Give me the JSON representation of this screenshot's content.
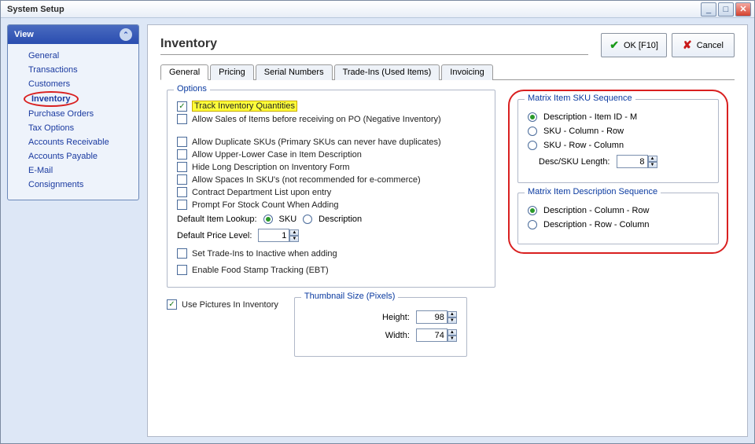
{
  "window_title": "System Setup",
  "buttons": {
    "ok": "OK [F10]",
    "cancel": "Cancel"
  },
  "sidebar": {
    "header": "View",
    "items": [
      {
        "label": "General"
      },
      {
        "label": "Transactions"
      },
      {
        "label": "Customers"
      },
      {
        "label": "Inventory",
        "active": true
      },
      {
        "label": "Purchase Orders"
      },
      {
        "label": "Tax Options"
      },
      {
        "label": "Accounts Receivable"
      },
      {
        "label": "Accounts Payable"
      },
      {
        "label": "E-Mail"
      },
      {
        "label": "Consignments"
      }
    ]
  },
  "page_title": "Inventory",
  "tabs": [
    {
      "label": "General",
      "active": true
    },
    {
      "label": "Pricing"
    },
    {
      "label": "Serial Numbers"
    },
    {
      "label": "Trade-Ins (Used Items)"
    },
    {
      "label": "Invoicing"
    }
  ],
  "options": {
    "legend": "Options",
    "track": "Track Inventory Quantities",
    "allow_neg": "Allow Sales of Items before receiving on PO (Negative Inventory)",
    "dup_sku": "Allow Duplicate SKUs (Primary SKUs can never have duplicates)",
    "upper_lower": "Allow Upper-Lower Case in Item Description",
    "hide_long": "Hide Long Description on Inventory Form",
    "spaces_sku": "Allow Spaces In SKU's (not recommended for e-commerce)",
    "contract_dept": "Contract Department List upon entry",
    "prompt_stock": "Prompt For Stock Count When Adding",
    "default_lookup_label": "Default Item Lookup:",
    "lookup_sku": "SKU",
    "lookup_desc": "Description",
    "default_price_label": "Default Price Level:",
    "default_price_value": "1",
    "tradeins": "Set Trade-Ins to Inactive when adding",
    "ebt": "Enable Food Stamp Tracking (EBT)"
  },
  "pictures": {
    "use_pics": "Use Pictures In Inventory",
    "thumb_legend": "Thumbnail Size (Pixels)",
    "height_label": "Height:",
    "height_value": "98",
    "width_label": "Width:",
    "width_value": "74"
  },
  "sku_seq": {
    "legend": "Matrix Item SKU Sequence",
    "opt1": "Description - Item ID - M",
    "opt2": "SKU - Column - Row",
    "opt3": "SKU - Row - Column",
    "len_label": "Desc/SKU Length:",
    "len_value": "8"
  },
  "desc_seq": {
    "legend": "Matrix Item Description Sequence",
    "opt1": "Description - Column - Row",
    "opt2": "Description - Row - Column"
  }
}
